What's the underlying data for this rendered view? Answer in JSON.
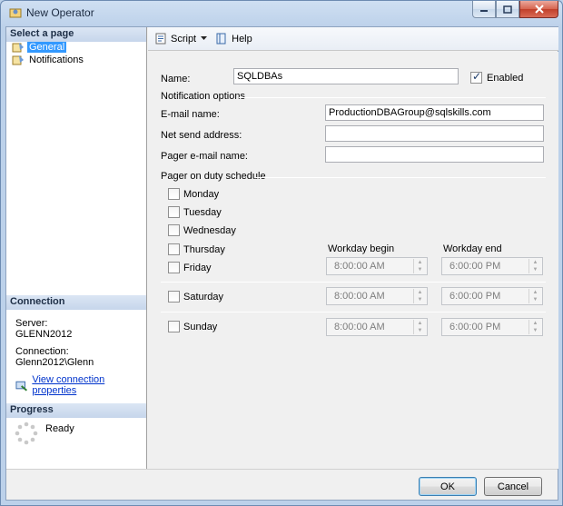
{
  "window": {
    "title": "New Operator"
  },
  "left": {
    "select_page": "Select a page",
    "pages": [
      "General",
      "Notifications"
    ],
    "connection_header": "Connection",
    "server_label": "Server:",
    "server_value": "GLENN2012",
    "connection_label": "Connection:",
    "connection_value": "Glenn2012\\Glenn",
    "view_link": "View connection properties",
    "progress_header": "Progress",
    "progress_status": "Ready"
  },
  "toolbar": {
    "script": "Script",
    "help": "Help"
  },
  "form": {
    "name_label": "Name:",
    "name_value": "SQLDBAs",
    "enabled_label": "Enabled",
    "enabled_checked": true,
    "notification_options": "Notification options",
    "email_label": "E-mail name:",
    "email_value": "ProductionDBAGroup@sqlskills.com",
    "netsend_label": "Net send address:",
    "netsend_value": "",
    "pager_label": "Pager e-mail name:",
    "pager_value": "",
    "schedule_title": "Pager on duty schedule",
    "days": [
      "Monday",
      "Tuesday",
      "Wednesday",
      "Thursday",
      "Friday"
    ],
    "saturday": "Saturday",
    "sunday": "Sunday",
    "workday_begin": "Workday begin",
    "workday_end": "Workday end",
    "friday_begin": "8:00:00 AM",
    "friday_end": "6:00:00 PM",
    "saturday_begin": "8:00:00 AM",
    "saturday_end": "6:00:00 PM",
    "sunday_begin": "8:00:00 AM",
    "sunday_end": "6:00:00 PM"
  },
  "buttons": {
    "ok": "OK",
    "cancel": "Cancel"
  }
}
